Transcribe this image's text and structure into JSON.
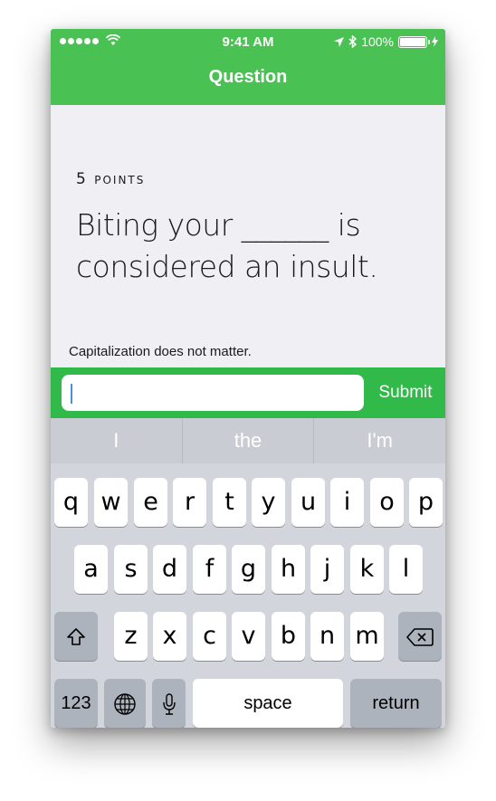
{
  "status": {
    "time": "9:41 AM",
    "battery": "100%",
    "battery_level": 1.0,
    "signal_icon": "signal-dots-icon",
    "wifi_icon": "wifi-icon",
    "location_icon": "location-arrow-icon",
    "bluetooth_icon": "bluetooth-icon",
    "charging_icon": "charging-bolt-icon"
  },
  "nav": {
    "title": "Question"
  },
  "question": {
    "points": "5 points",
    "text": "Biting your ______ is considered an insult.",
    "hint": "Capitalization does not matter."
  },
  "answer": {
    "value": "",
    "placeholder": "",
    "submit_label": "Submit"
  },
  "keyboard": {
    "suggestions": [
      "I",
      "the",
      "I'm"
    ],
    "row1": [
      "q",
      "w",
      "e",
      "r",
      "t",
      "y",
      "u",
      "i",
      "o",
      "p"
    ],
    "row2": [
      "a",
      "s",
      "d",
      "f",
      "g",
      "h",
      "j",
      "k",
      "l"
    ],
    "row3": [
      "z",
      "x",
      "c",
      "v",
      "b",
      "n",
      "m"
    ],
    "numbers_label": "123",
    "space_label": "space",
    "return_label": "return",
    "shift_icon": "shift-icon",
    "delete_icon": "delete-icon",
    "globe_icon": "globe-icon",
    "mic_icon": "microphone-icon"
  },
  "colors": {
    "header": "#4ac253",
    "answer_bar": "#31b94a",
    "keyboard": "#d2d5db"
  }
}
